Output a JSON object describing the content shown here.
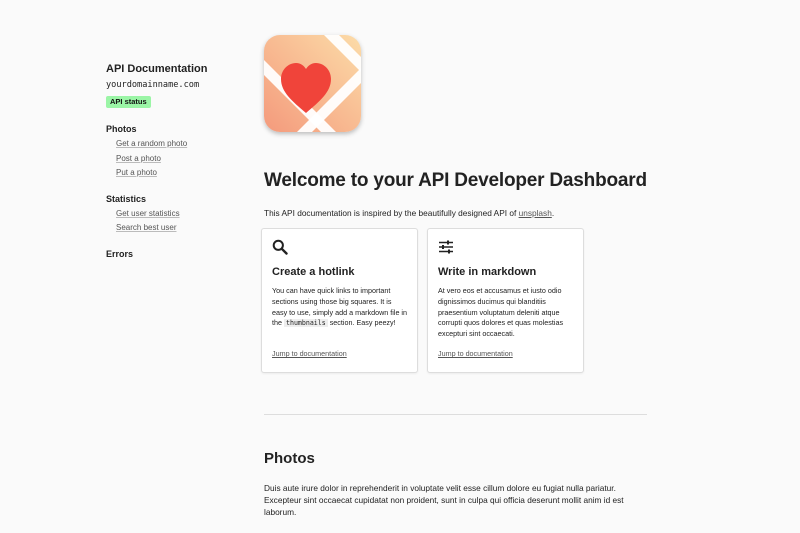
{
  "sidebar": {
    "title": "API Documentation",
    "domain": "yourdomainname.com",
    "status_badge": "API status",
    "sections": [
      {
        "title": "Photos",
        "links": [
          "Get a random photo",
          "Post a photo",
          "Put a photo"
        ]
      },
      {
        "title": "Statistics",
        "links": [
          "Get user statistics",
          "Search best user"
        ]
      },
      {
        "title": "Errors",
        "links": []
      }
    ]
  },
  "main": {
    "title": "Welcome to your API Developer Dashboard",
    "intro_prefix": "This API documentation is inspired by the beautifully designed API of ",
    "intro_link": "unsplash",
    "intro_suffix": ".",
    "cards": [
      {
        "icon": "search-icon",
        "title": "Create a hotlink",
        "text_before": "You can have quick links to important sections using those big squares. It is easy to use, simply add a markdown file in the ",
        "code": "thumbnails",
        "text_after": " section. Easy peezy!",
        "link": "Jump to documentation"
      },
      {
        "icon": "sliders-icon",
        "title": "Write in markdown",
        "text_before": "At vero eos et accusamus et iusto odio dignissimos ducimus qui blanditiis praesentium voluptatum deleniti atque corrupti quos dolores et quas molestias excepturi sint occaecati.",
        "code": "",
        "text_after": "",
        "link": "Jump to documentation"
      }
    ],
    "section_title": "Photos",
    "section_text": "Duis aute irure dolor in reprehenderit in voluptate velit esse cillum dolore eu fugiat nulla pariatur. Excepteur sint occaecat cupidatat non proident, sunt in culpa qui officia deserunt mollit anim id est laborum."
  },
  "colors": {
    "badge": "#9bf5a6",
    "logo_heart": "#f0443a",
    "logo_bg_start": "#f7a889",
    "logo_bg_end": "#fbd9a8"
  }
}
